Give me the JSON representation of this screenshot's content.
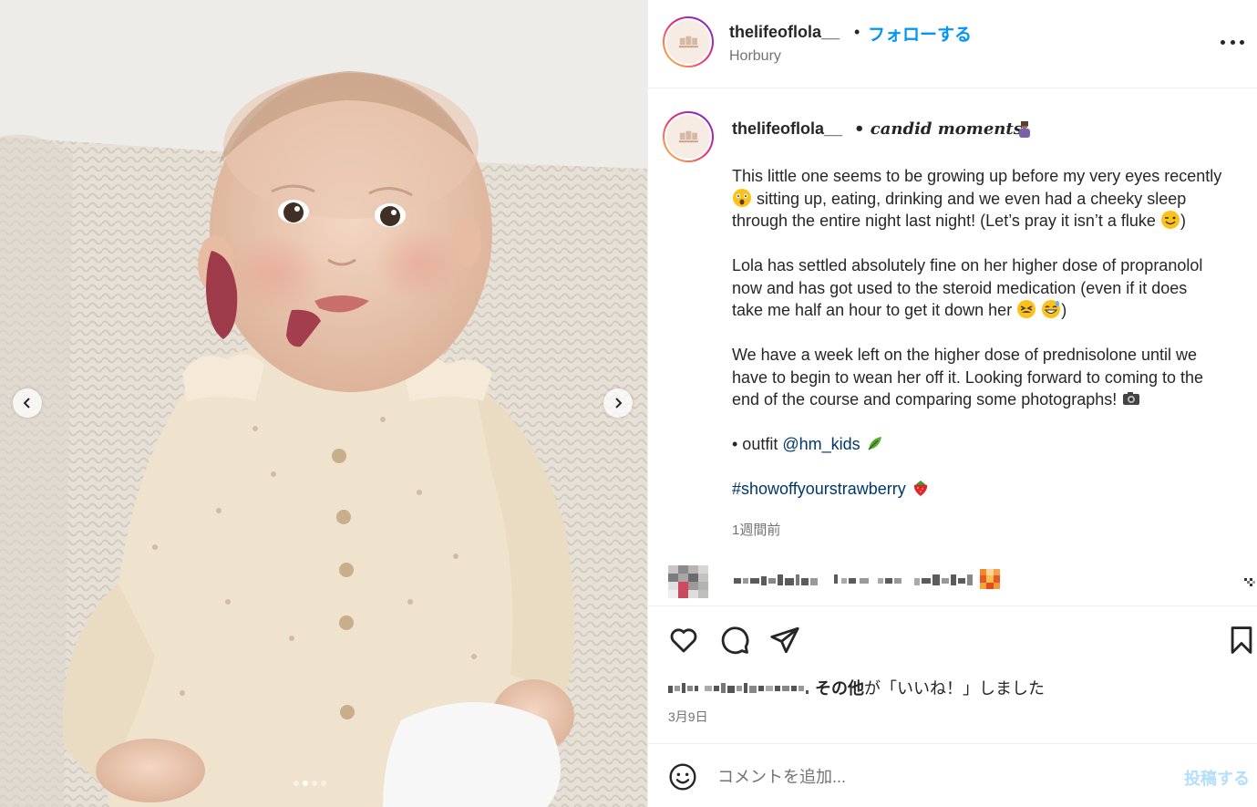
{
  "post": {
    "username": "thelifeoflola__",
    "separator": "•",
    "follow_label": "フォローする",
    "location": "Horbury",
    "more_icon": "more-horizontal-icon"
  },
  "caption": {
    "username": "thelifeoflola__",
    "title": "• candid moments",
    "title_emoji": "woman-emoji",
    "paragraphs": {
      "p1_line1": "This little one seems to be growing up before my very eyes recently",
      "p1_line2": " sitting up, eating, drinking and we even had a cheeky sleep",
      "p1_line3": "through the entire night last night! (Let’s pray it isn’t a fluke ",
      "p1_line3_end": ")",
      "p2_line1": "Lola has settled absolutely fine on her higher dose of propranolol",
      "p2_line2": "now and has got used to the steroid medication (even if it does",
      "p2_line3": "take me half an hour to get it down her ",
      "p2_line3_end": ")",
      "p3_line1": "We have a week left on the higher dose of prednisolone until we",
      "p3_line2": "have to begin to wean her off it. Looking forward to coming to the",
      "p3_line3": "end of the course and comparing some photographs! ",
      "outfit_prefix": "• outfit ",
      "outfit_link": "@hm_kids",
      "hashtag": "#showoffyourstrawberry"
    },
    "time_ago": "1週間前"
  },
  "likes": {
    "others_label": "その他",
    "suffix": "が「いいね！」しました",
    "date": "3月9日"
  },
  "comment_box": {
    "placeholder": "コメントを追加...",
    "post_label": "投稿する"
  },
  "carousel": {
    "total": 4,
    "active": 2
  },
  "colors": {
    "accent": "#0095f6",
    "text": "#262626",
    "muted": "#737373",
    "link": "#00376b",
    "post_disabled": "#b2dffc"
  }
}
